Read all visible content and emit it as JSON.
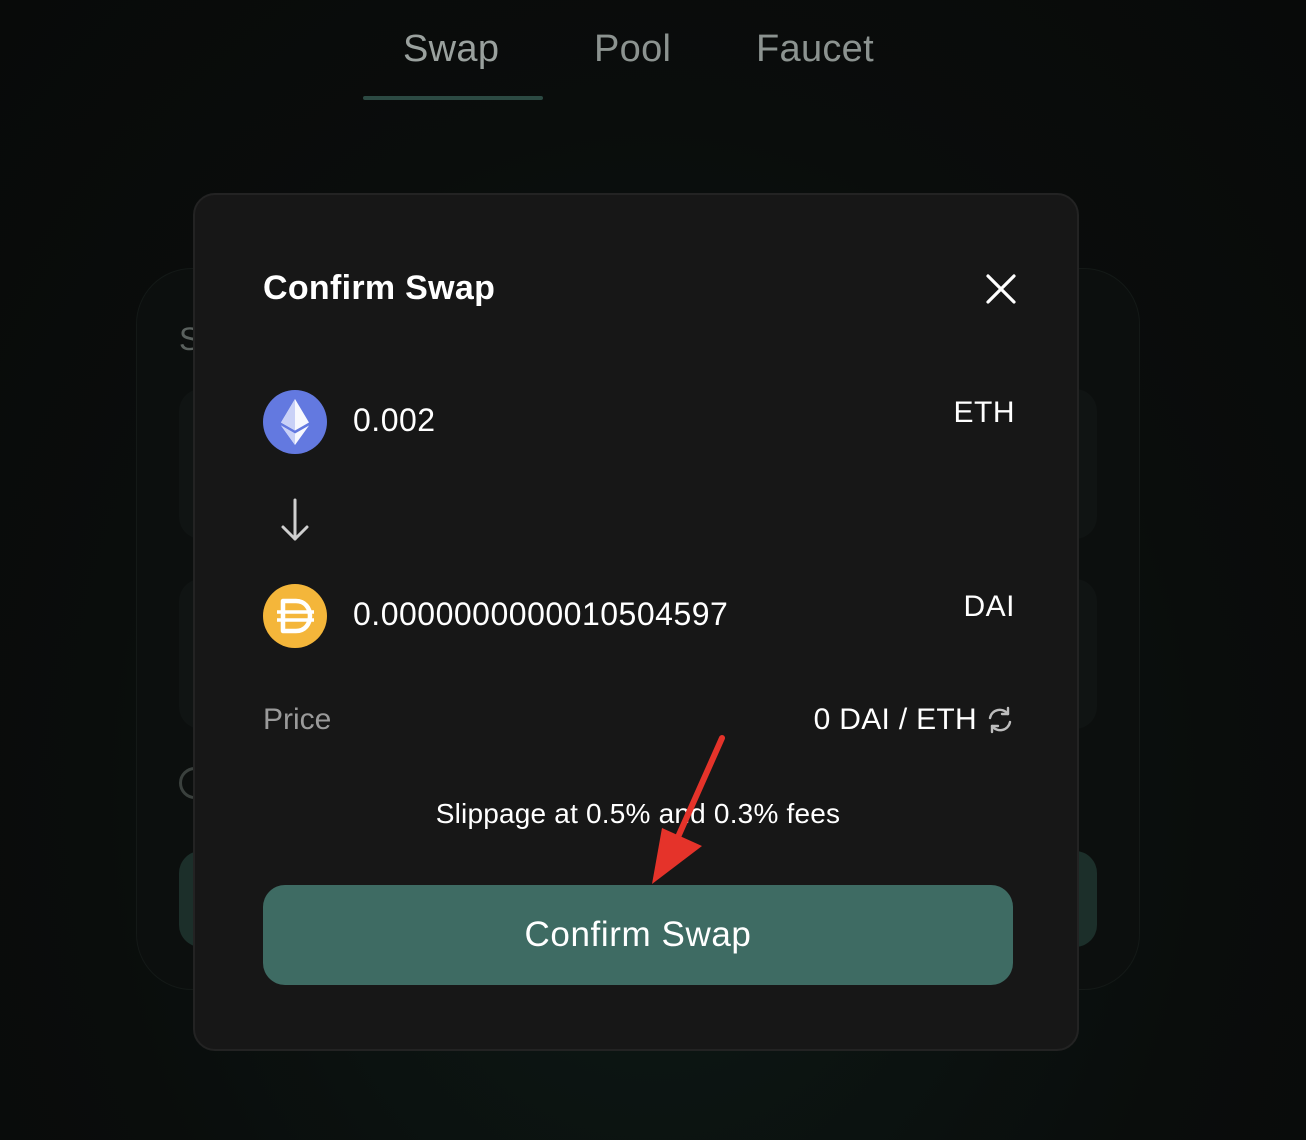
{
  "nav": {
    "tabs": [
      {
        "label": "Swap",
        "active": true
      },
      {
        "label": "Pool",
        "active": false
      },
      {
        "label": "Faucet",
        "active": false
      }
    ]
  },
  "background_card": {
    "label_partial": "S"
  },
  "modal": {
    "title": "Confirm Swap",
    "close_icon": "close-icon",
    "from": {
      "amount": "0.002",
      "symbol": "ETH",
      "icon": "eth-icon",
      "icon_color": "#6379e0"
    },
    "direction_icon": "arrow-down-icon",
    "to": {
      "amount": "0.0000000000010504597",
      "symbol": "DAI",
      "icon": "dai-icon",
      "icon_color": "#f4b63a"
    },
    "price": {
      "label": "Price",
      "value": "0 DAI / ETH",
      "icon": "refresh-icon"
    },
    "slippage_text": "Slippage at 0.5% and 0.3% fees",
    "confirm_label": "Confirm Swap",
    "confirm_color": "#3e6b63"
  },
  "annotation": {
    "arrow_color": "#e5332a"
  }
}
